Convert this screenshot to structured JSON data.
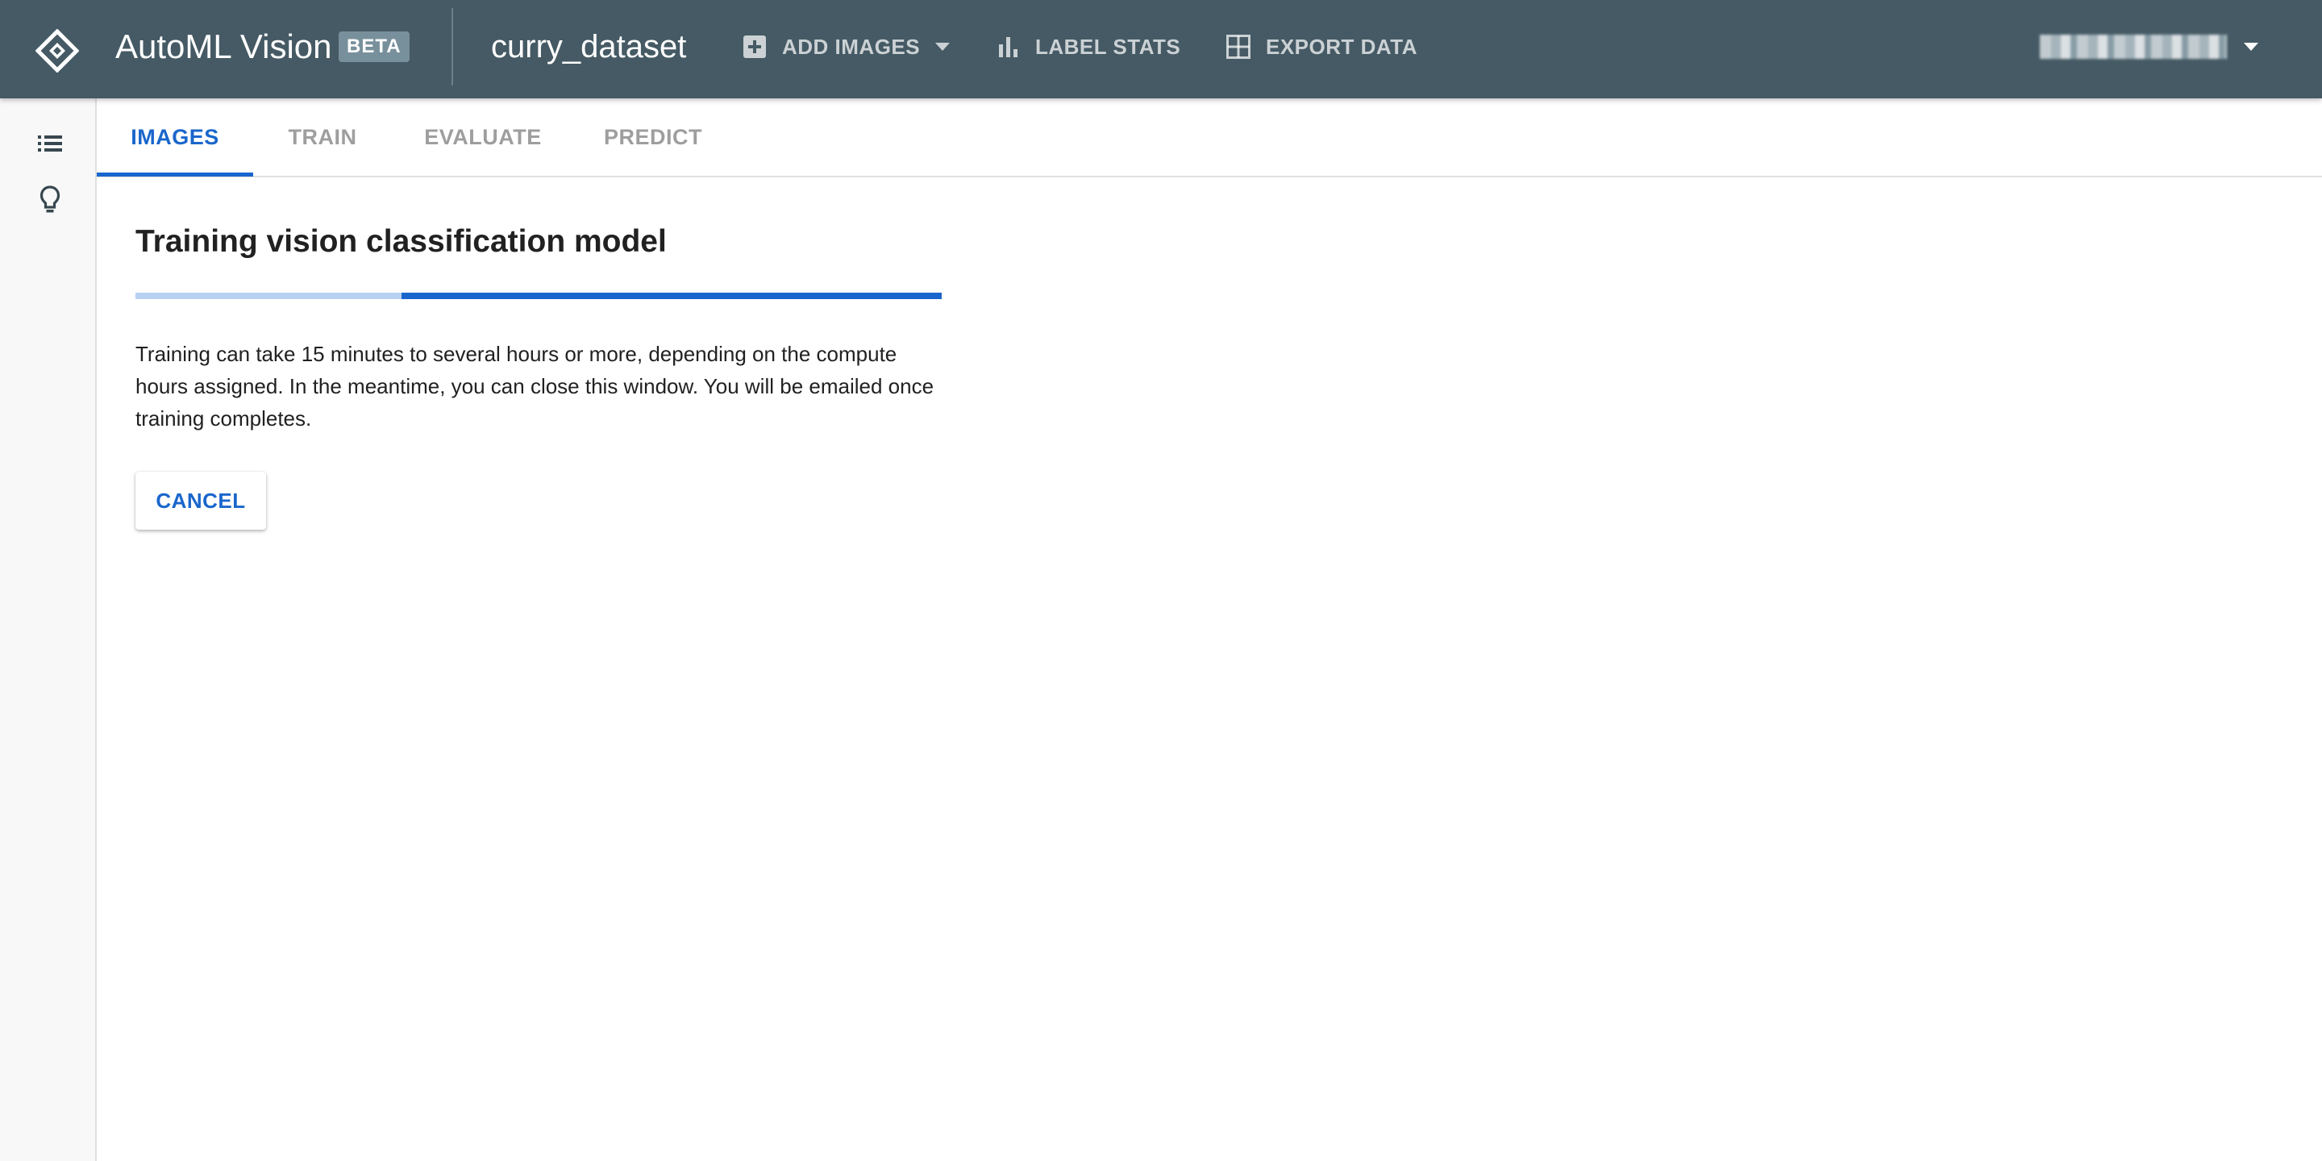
{
  "app": {
    "title": "AutoML Vision",
    "badge": "BETA",
    "dataset": "curry_dataset",
    "brand_color": "#455a64",
    "accent_color": "#1a66cc"
  },
  "toolbar": {
    "add_images": "ADD IMAGES",
    "label_stats": "LABEL STATS",
    "export_data": "EXPORT DATA",
    "icons": [
      "automl-logo-icon",
      "add-box-icon",
      "dropdown-arrow-icon",
      "bar-chart-icon",
      "grid-icon",
      "account-dropdown-icon"
    ]
  },
  "sidebar": {
    "items": [
      {
        "icon": "list-icon"
      },
      {
        "icon": "lightbulb-icon"
      }
    ]
  },
  "tabs": [
    {
      "label": "IMAGES",
      "active": true
    },
    {
      "label": "TRAIN",
      "active": false
    },
    {
      "label": "EVALUATE",
      "active": false
    },
    {
      "label": "PREDICT",
      "active": false
    }
  ],
  "main": {
    "heading": "Training vision classification model",
    "progress_fraction_indeterminate_start": 0.33,
    "body": "Training can take 15 minutes to several hours or more, depending on the compute hours assigned. In the meantime, you can close this window. You will be emailed once training completes.",
    "cancel_label": "CANCEL"
  }
}
